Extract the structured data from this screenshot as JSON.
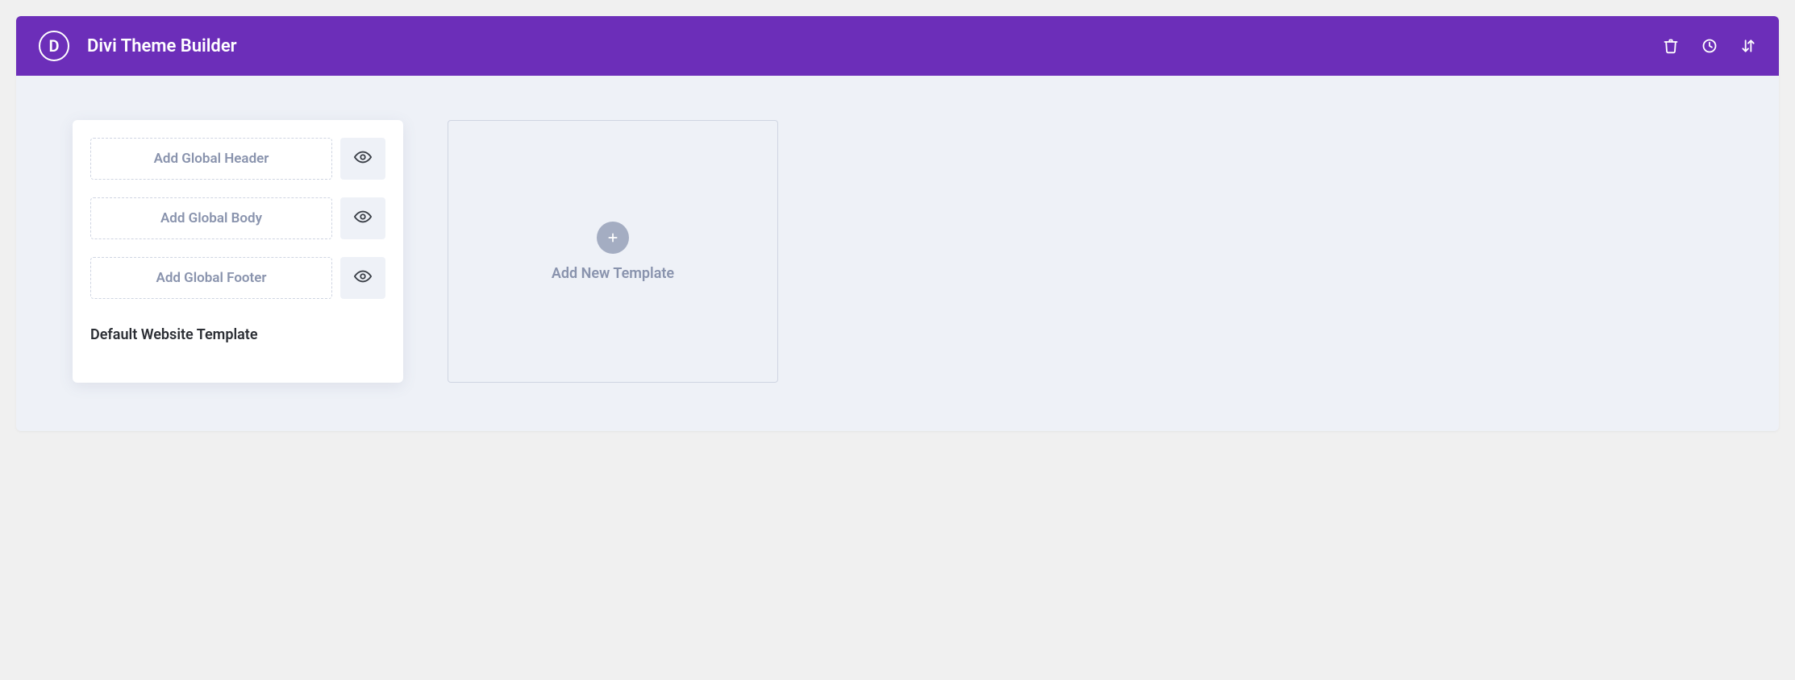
{
  "header": {
    "logo_letter": "D",
    "title": "Divi Theme Builder",
    "icons": [
      "trash-icon",
      "history-icon",
      "import-export-icon"
    ]
  },
  "template_card": {
    "slots": [
      {
        "label": "Add Global Header"
      },
      {
        "label": "Add Global Body"
      },
      {
        "label": "Add Global Footer"
      }
    ],
    "title": "Default Website Template"
  },
  "add_card": {
    "label": "Add New Template"
  }
}
